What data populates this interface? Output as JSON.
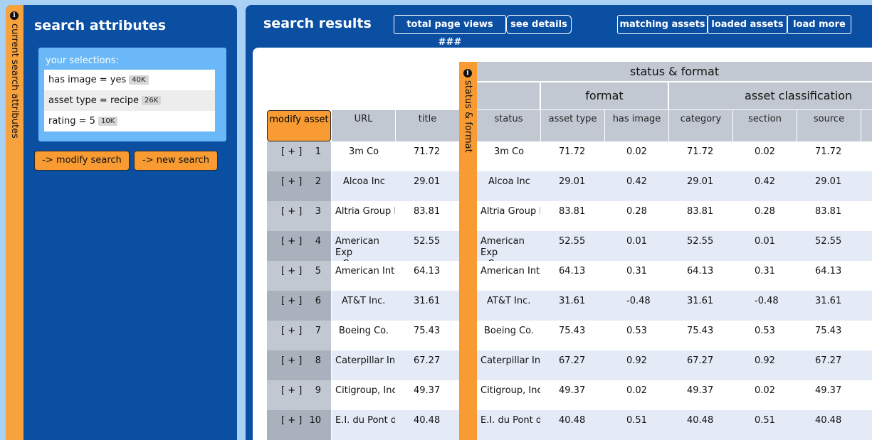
{
  "left": {
    "strip_label": "current search attributes",
    "title": "search attributes",
    "selections_label": "your selections:",
    "selections": [
      {
        "text": "has image = yes",
        "count": "40K"
      },
      {
        "text": "asset type = recipe",
        "count": "26K"
      },
      {
        "text": "rating = 5",
        "count": "10K"
      }
    ],
    "modify_search": "-> modify search",
    "new_search": "-> new search"
  },
  "right": {
    "title": "search results",
    "buttons": {
      "total": "total page views ###",
      "details": "see details",
      "matching": "matching assets",
      "loaded": "loaded assets",
      "load_more": "load more"
    }
  },
  "table": {
    "modify_asset": "modify asset",
    "status_strip_label": "status & format",
    "group_top": "status & format",
    "group_format": "format",
    "group_classification": "asset classification",
    "columns": {
      "url": "URL",
      "title": "title",
      "status": "status",
      "asset_type": "asset type",
      "has_image": "has image",
      "category": "category",
      "section": "section",
      "source": "source"
    },
    "plus_label": "[ + ]",
    "rows": [
      {
        "n": "1",
        "url": "3m Co",
        "title": "71.72",
        "status": "3m Co",
        "asset_type": "71.72",
        "has_image": "0.02",
        "category": "71.72",
        "section": "0.02",
        "source": "71.72"
      },
      {
        "n": "2",
        "url": "Alcoa Inc",
        "title": "29.01",
        "status": "Alcoa Inc",
        "asset_type": "29.01",
        "has_image": "0.42",
        "category": "29.01",
        "section": "0.42",
        "source": "29.01"
      },
      {
        "n": "3",
        "url": "Altria Group I",
        "title": "83.81",
        "status": "Altria Group I",
        "asset_type": "83.81",
        "has_image": "0.28",
        "category": "83.81",
        "section": "0.28",
        "source": "83.81"
      },
      {
        "n": "4",
        "url": "American Exp Company",
        "title": "52.55",
        "status": "American Exp Company",
        "asset_type": "52.55",
        "has_image": "0.01",
        "category": "52.55",
        "section": "0.01",
        "source": "52.55"
      },
      {
        "n": "5",
        "url": "American Inte",
        "title": "64.13",
        "status": "American Inte",
        "asset_type": "64.13",
        "has_image": "0.31",
        "category": "64.13",
        "section": "0.31",
        "source": "64.13"
      },
      {
        "n": "6",
        "url": "AT&T Inc.",
        "title": "31.61",
        "status": "AT&T Inc.",
        "asset_type": "31.61",
        "has_image": "-0.48",
        "category": "31.61",
        "section": "-0.48",
        "source": "31.61"
      },
      {
        "n": "7",
        "url": "Boeing Co.",
        "title": "75.43",
        "status": "Boeing Co.",
        "asset_type": "75.43",
        "has_image": "0.53",
        "category": "75.43",
        "section": "0.53",
        "source": "75.43"
      },
      {
        "n": "8",
        "url": "Caterpillar Inc",
        "title": "67.27",
        "status": "Caterpillar Inc",
        "asset_type": "67.27",
        "has_image": "0.92",
        "category": "67.27",
        "section": "0.92",
        "source": "67.27"
      },
      {
        "n": "9",
        "url": "Citigroup, Inc",
        "title": "49.37",
        "status": "Citigroup, Inc",
        "asset_type": "49.37",
        "has_image": "0.02",
        "category": "49.37",
        "section": "0.02",
        "source": "49.37"
      },
      {
        "n": "10",
        "url": "E.I. du Pont de",
        "title": "40.48",
        "status": "E.I. du Pont de",
        "asset_type": "40.48",
        "has_image": "0.51",
        "category": "40.48",
        "section": "0.51",
        "source": "40.48"
      }
    ]
  }
}
